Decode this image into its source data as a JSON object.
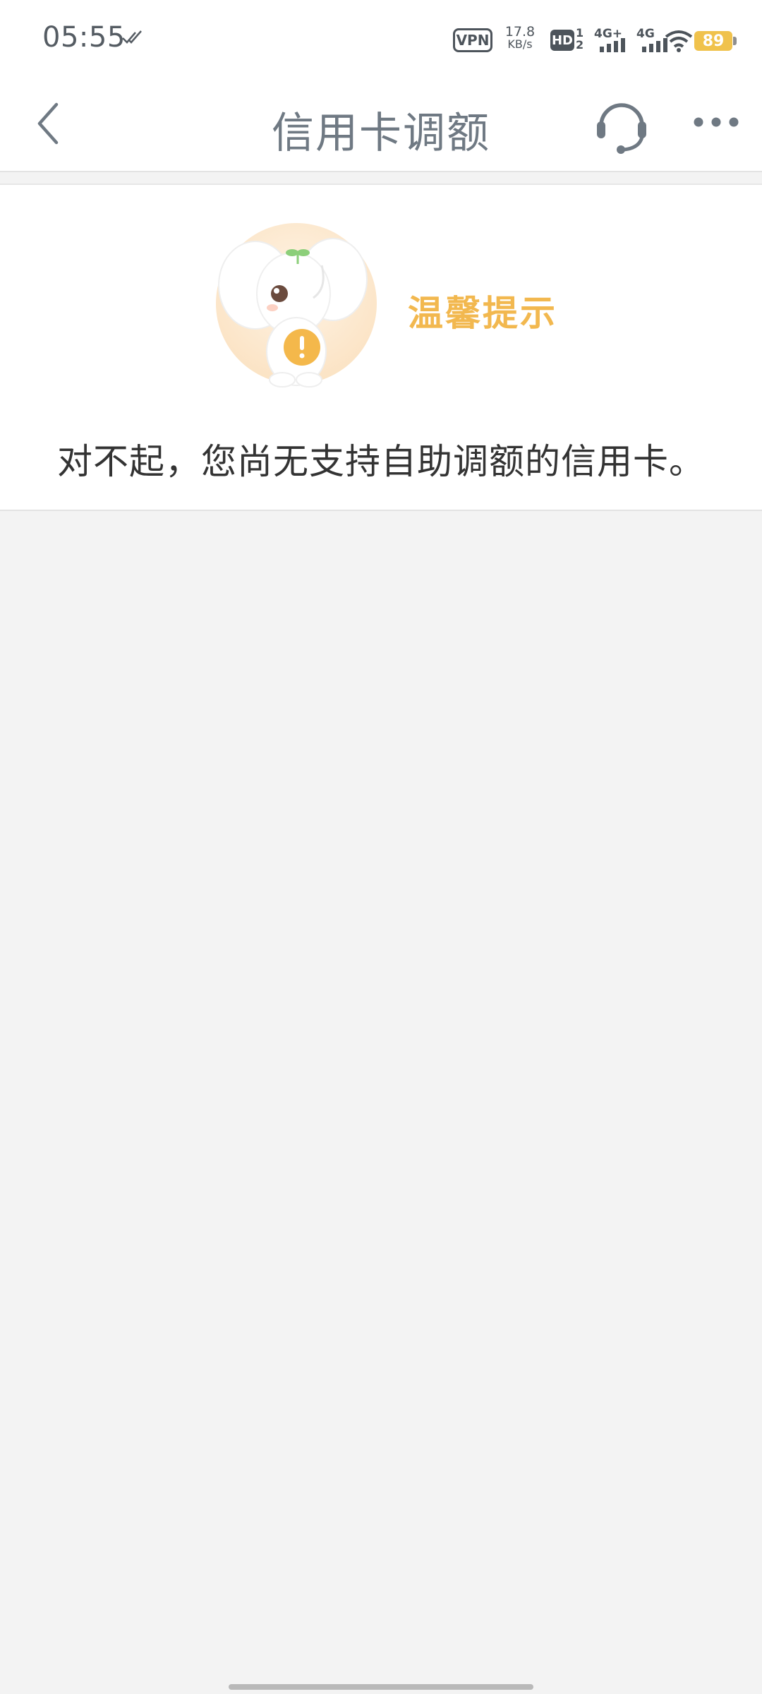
{
  "status_bar": {
    "time": "05:55",
    "vpn": "VPN",
    "net_speed_value": "17.8",
    "net_speed_unit": "KB/s",
    "hd_label": "HD",
    "hd_sub_top": "1",
    "hd_sub_bottom": "2",
    "signal1_label": "4G+",
    "signal2_label": "4G",
    "battery": "89",
    "battery_color": "#f0c24c"
  },
  "navbar": {
    "title": "信用卡调额",
    "back_icon": "chevron-left-icon",
    "service_icon": "headset-icon",
    "more_icon": "more-dots-icon"
  },
  "notice": {
    "tip_title": "温馨提示",
    "message": "对不起，您尚无支持自助调额的信用卡。",
    "accent_color": "#f2b84f"
  }
}
